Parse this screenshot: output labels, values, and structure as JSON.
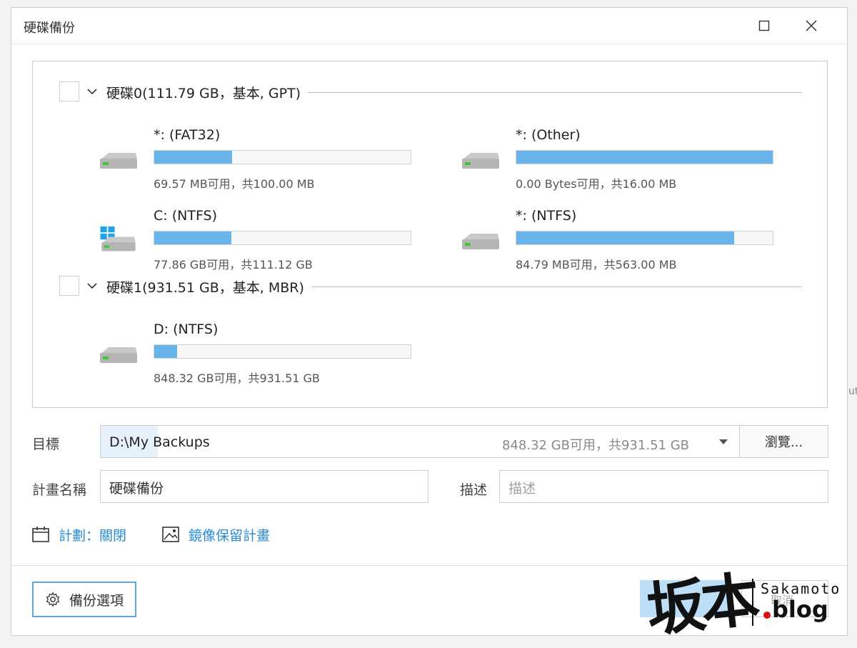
{
  "window": {
    "title": "硬碟備份"
  },
  "disks": [
    {
      "label": "硬碟0(111.79 GB，基本, GPT)",
      "partitions": [
        {
          "label": "*: (FAT32)",
          "info": "69.57 MB可用，共100.00 MB",
          "usage": 0.304,
          "icon": "hard-drive-icon"
        },
        {
          "label": "*: (Other)",
          "info": "0.00 Bytes可用，共16.00 MB",
          "usage": 1.0,
          "icon": "hard-drive-icon"
        },
        {
          "label": "C: (NTFS)",
          "info": "77.86 GB可用，共111.12 GB",
          "usage": 0.3,
          "icon": "windows-drive-icon"
        },
        {
          "label": "*: (NTFS)",
          "info": "84.79 MB可用，共563.00 MB",
          "usage": 0.85,
          "icon": "hard-drive-icon"
        }
      ]
    },
    {
      "label": "硬碟1(931.51 GB，基本, MBR)",
      "partitions": [
        {
          "label": "D: (NTFS)",
          "info": "848.32 GB可用，共931.51 GB",
          "usage": 0.089,
          "icon": "hard-drive-icon"
        }
      ]
    }
  ],
  "target": {
    "label": "目標",
    "path": "D:\\My Backups",
    "space": "848.32 GB可用，共931.51 GB",
    "browse_label": "瀏覽..."
  },
  "plan": {
    "name_label": "計畫名稱",
    "name_value": "硬碟備份",
    "desc_label": "描述",
    "desc_placeholder": "描述"
  },
  "links": {
    "schedule": "計劃：關閉",
    "image_retention": "鏡像保留計畫"
  },
  "footer": {
    "options_label": "備份選項",
    "secondary_label": "取消"
  },
  "watermark": {
    "cjk": "坂本",
    "latin": "Sakamoto",
    "blog": "blog"
  },
  "colors": {
    "bar_fill": "#6ab4ec",
    "link": "#2a8ad4",
    "accent_border": "#5ea9dd"
  }
}
